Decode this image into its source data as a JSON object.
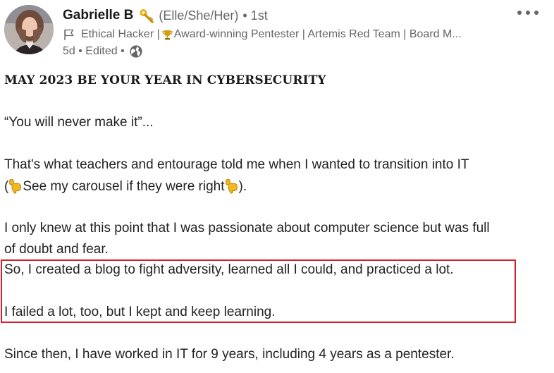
{
  "author": {
    "name": "Gabrielle B",
    "pronouns": "(Elle/She/Her)",
    "connection_degree": "• 1st",
    "headline_prefix": "Ethical Hacker |",
    "headline_suffix": "Award-winning Pentester | Artemis Red Team | Board M...",
    "post_meta": "5d • Edited •",
    "icons": {
      "name_badge": "key-icon",
      "headline_badge": "flag-icon",
      "award": "trophy-icon",
      "visibility": "globe-icon"
    }
  },
  "actions": {
    "more": "ellipsis-icon"
  },
  "post": {
    "title": "MAY 2023 BE YOUR YEAR IN CYBERSECURITY",
    "line1": "“You will never make it”...",
    "line2": "That's what teachers and entourage told me when I wanted to transition into IT",
    "line3_open": "(",
    "line3_text": "See my carousel if they were right",
    "line3_close": ").",
    "line4": "I only knew at this point that I was passionate about computer science but was full",
    "line5": "of doubt and fear.",
    "line6": "So, I created a blog to fight adversity, learned all I could, and practiced a lot.",
    "line7": "I failed a lot, too, but I kept and keep learning.",
    "line8": "Since then, I have worked in IT for 9 years, including 4 years as a pentester."
  },
  "annotation": {
    "highlight_color": "#d21f2b"
  },
  "colors": {
    "primary_text": "#191919",
    "secondary_text": "#666666",
    "key_yellow": "#e7b21a",
    "pointing_hand_yellow": "#f1b91f",
    "trophy_gold": "#d49d12"
  }
}
